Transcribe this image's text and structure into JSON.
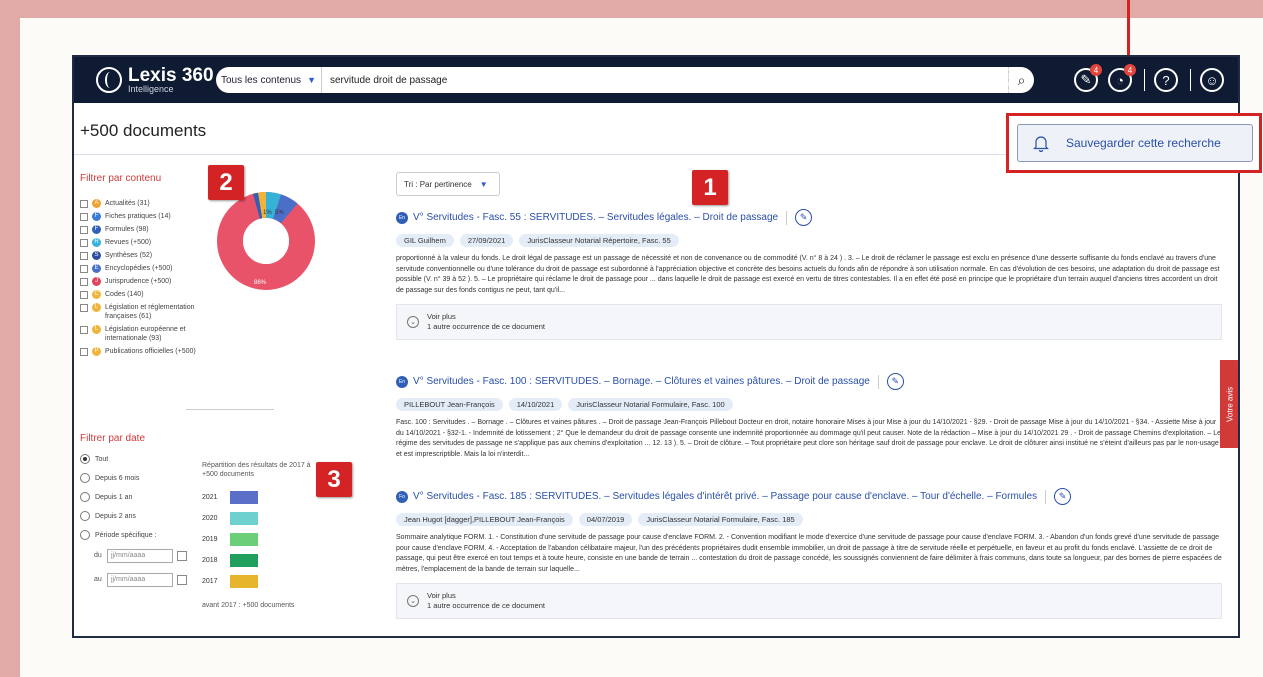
{
  "app": {
    "logo_name": "Lexis 360",
    "logo_sub": "Intelligence"
  },
  "search": {
    "scope": "Tous les contenus",
    "query": "servitude droit de passage",
    "advanced": "recherche avancée"
  },
  "toolbar": {
    "badge1": "4",
    "badge2": "4"
  },
  "results_count": "+500 documents",
  "filter_content": {
    "title": "Filtrer par contenu",
    "items": [
      {
        "label": "Actualités (31)",
        "color": "#f0a030",
        "glyph": "A"
      },
      {
        "label": "Fiches pratiques (14)",
        "color": "#3a7bd5",
        "glyph": "F"
      },
      {
        "label": "Formules (98)",
        "color": "#2f5fb7",
        "glyph": "F"
      },
      {
        "label": "Revues (+500)",
        "color": "#35b2d8",
        "glyph": "R"
      },
      {
        "label": "Synthèses (52)",
        "color": "#2b4ea0",
        "glyph": "S"
      },
      {
        "label": "Encyclopédies (+500)",
        "color": "#4a6fc8",
        "glyph": "E"
      },
      {
        "label": "Jurisprudence (+500)",
        "color": "#e2455a",
        "glyph": "J"
      },
      {
        "label": "Codes (140)",
        "color": "#f0b43a",
        "glyph": "C"
      },
      {
        "label": "Législation et réglementation françaises (61)",
        "color": "#f0b43a",
        "glyph": "L"
      },
      {
        "label": "Législation européenne et internationale (93)",
        "color": "#f0b43a",
        "glyph": "L"
      },
      {
        "label": "Publications officielles (+500)",
        "color": "#f0b43a",
        "glyph": "P"
      }
    ]
  },
  "donut": {
    "label_big": "86%",
    "label_a": "1%",
    "label_b": "5%"
  },
  "filter_date": {
    "title": "Filtrer par date",
    "options": [
      "Tout",
      "Depuis 6 mois",
      "Depuis 1 an",
      "Depuis 2 ans",
      "Période spécifique :"
    ],
    "du": "du",
    "au": "au",
    "placeholder": "jj/mm/aaaa"
  },
  "repartition": {
    "line1": "Répartition des résultats de 2017 à",
    "line2": "+500 documents",
    "years": [
      {
        "year": "2021",
        "color": "#5b6fc7"
      },
      {
        "year": "2020",
        "color": "#6fd0d0"
      },
      {
        "year": "2019",
        "color": "#6bcf7a"
      },
      {
        "year": "2018",
        "color": "#1fa05e"
      },
      {
        "year": "2017",
        "color": "#e6b52c"
      }
    ],
    "avant": "avant 2017 : +500 documents"
  },
  "sort": {
    "label": "Tri : Par pertinence"
  },
  "results": [
    {
      "logo": "En",
      "title": "V° Servitudes - Fasc. 55 : SERVITUDES. – Servitudes légales. – Droit de passage",
      "tags": [
        "GIL Guilhem",
        "27/09/2021",
        "JurisClasseur Notarial Répertoire, Fasc. 55"
      ],
      "text": "proportionné à la valeur du fonds. Le droit légal de passage est un passage de nécessité et non de convenance ou de commodité (V.  n° 8 à 24 ) . 3. – Le droit de réclamer le passage est exclu en présence d'une desserte suffisante du fonds enclavé au travers d'une servitude conventionnelle ou d'une tolérance du droit de passage est subordonné à l'appréciation objective et concrète des besoins actuels du fonds afin de répondre à son utilisation normale. En cas d'évolution de ces besoins, une adaptation du droit de passage est possible (V.  n° 39 à 52 ). 5. – Le propriétaire qui réclame le droit de passage pour ... dans laquelle le droit de passage est exercé en vertu de titres contestables. Il a en effet été posé en principe que le propriétaire d'un terrain auquel d'anciens titres accordent un droit de passage sur des fonds contigus ne peut, tant qu'il...",
      "more_title": "Voir plus",
      "more_sub": "1 autre occurrence de ce document"
    },
    {
      "logo": "En",
      "title": "V° Servitudes - Fasc. 100 : SERVITUDES. – Bornage. – Clôtures et vaines pâtures. – Droit de passage",
      "tags": [
        "PILLEBOUT Jean-François",
        "14/10/2021",
        "JurisClasseur Notarial Formulaire, Fasc. 100"
      ],
      "text": "Fasc. 100 : Servitudes . – Bornage . – Clôtures et vaines pâtures . – Droit de passage Jean-François Pillebout Docteur en droit, notaire honoraire Mises à jour Mise à jour du 14/10/2021 - §29. - Droit de passage Mise à jour du 14/10/2021 - §34. - Assiette Mise à jour du 14/10/2021 - §32-1. - Indemnité de lotissement ;  2° Que le demandeur du droit de passage consente une indemnité proportionnée au dommage qu'il peut causer. Note de la rédaction – Mise à jour du 14/10/2021 29 . - Droit de passage Chemins d'exploitation. – Le régime des servitudes de passage ne s'applique pas aux chemins d'exploitation ... 12. 13 ). 5. – Droit de clôture. – Tout propriétaire peut clore son héritage sauf droit de passage pour enclave. Le droit de clôturer ainsi institué ne s'éteint d'ailleurs pas par le non-usage et est imprescriptible. Mais la loi n'interdit..."
    },
    {
      "logo": "Fo",
      "title": "V° Servitudes - Fasc. 185 : SERVITUDES. – Servitudes légales d'intérêt privé. – Passage pour cause d'enclave. – Tour d'échelle. – Formules",
      "tags": [
        "Jean Hugot [dagger],PILLEBOUT Jean-François",
        "04/07/2019",
        "JurisClasseur Notarial Formulaire, Fasc. 185"
      ],
      "text": "Sommaire analytique FORM. 1. - Constitution d'une servitude de passage pour cause d'enclave FORM. 2. - Convention modifiant le mode d'exercice d'une servitude de passage pour cause d'enclave FORM. 3. - Abandon d'un fonds grevé d'une servitude de passage pour cause d'enclave FORM. 4. - Acceptation de l'abandon célibataire majeur, l'un des précédents propriétaires dudit ensemble immobilier, un droit de passage à titre de servitude réelle et perpétuelle, en faveur et au profit du fonds enclavé. L'assiette de ce droit de passage, qui peut être exercé en tout temps et à toute heure, consiste en une bande de terrain ... contestation du droit de passage concédé, les soussignés conviennent de faire délimiter à frais communs, dans toute sa longueur, par des bornes de pierre espacées de mètres, l'emplacement de la bande de terrain sur laquelle...",
      "more_title": "Voir plus",
      "more_sub": "1 autre occurrence de ce document"
    }
  ],
  "side_tab": "Votre avis",
  "save_search": "Sauvegarder cette recherche",
  "callouts": [
    "1",
    "2",
    "3"
  ]
}
